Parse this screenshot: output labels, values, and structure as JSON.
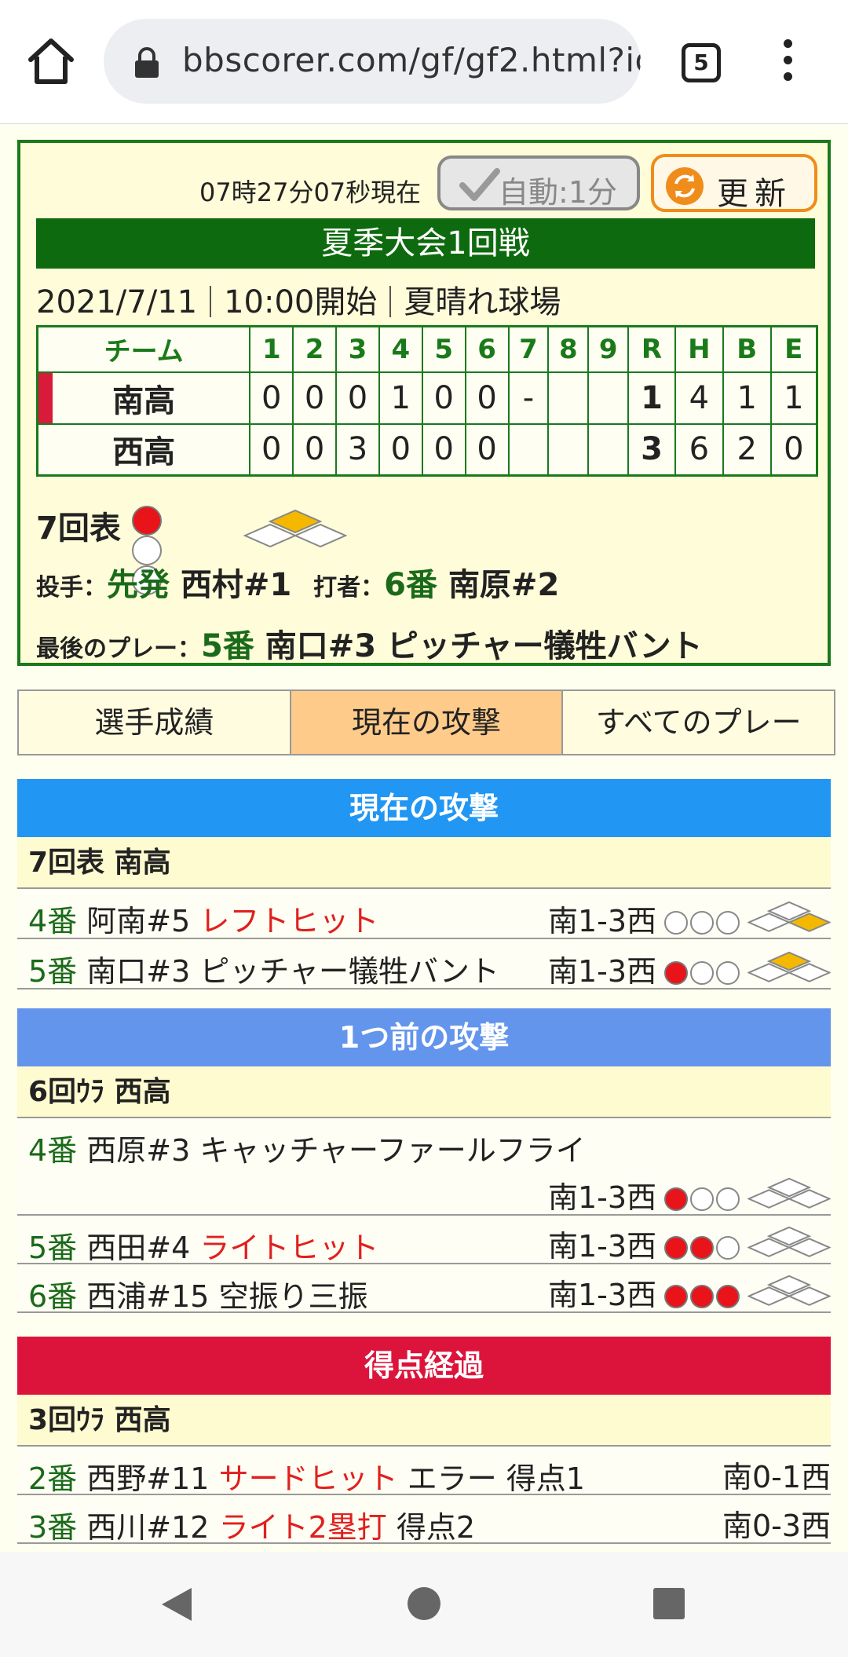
{
  "browser": {
    "url": "bbscorer.com/gf/gf2.html?id",
    "tab_count": "5"
  },
  "score": {
    "time_text": "07時27分07秒現在",
    "auto_label": "自動:1分",
    "refresh_label": "更新",
    "tournament": "夏季大会1回戦",
    "date": "2021/7/11",
    "start": "10:00開始",
    "venue": "夏晴れ球場",
    "headers": [
      "チーム",
      "1",
      "2",
      "3",
      "4",
      "5",
      "6",
      "7",
      "8",
      "9",
      "R",
      "H",
      "B",
      "E"
    ],
    "teams": [
      {
        "name": "南高",
        "innings": [
          "0",
          "0",
          "0",
          "1",
          "0",
          "0",
          "-",
          "",
          ""
        ],
        "r": "1",
        "h": "4",
        "b": "1",
        "e": "1",
        "batting": true
      },
      {
        "name": "西高",
        "innings": [
          "0",
          "0",
          "3",
          "0",
          "0",
          "0",
          "",
          "",
          ""
        ],
        "r": "3",
        "h": "6",
        "b": "2",
        "e": "0",
        "batting": false
      }
    ],
    "inning": "7回表",
    "outs": 1,
    "runners": {
      "first": false,
      "second": true,
      "third": false
    },
    "pitcher_label": "投手：",
    "pitcher_role": "先発",
    "pitcher_name": "西村#1",
    "batter_label": "打者：",
    "batter_order": "6番",
    "batter_name": "南原#2",
    "lastplay_label": "最後のプレー：",
    "lastplay_order": "5番",
    "lastplay_text": "南口#3 ピッチャー犠牲バント"
  },
  "tabs": [
    {
      "label": "選手成績",
      "active": false
    },
    {
      "label": "現在の攻撃",
      "active": true
    },
    {
      "label": "すべてのプレー",
      "active": false
    }
  ],
  "sections": {
    "current": {
      "header": "現在の攻撃",
      "color": "#2196f3",
      "sub": "7回表 南高",
      "plays": [
        {
          "order": "4番",
          "player": "阿南#5",
          "result": "レフトヒット",
          "extra": "",
          "score": "南1-3西",
          "outs": 0,
          "first": true,
          "second": false,
          "third": false
        },
        {
          "order": "5番",
          "player": "南口#3",
          "result": "",
          "extra": "ピッチャー犠牲バント",
          "score": "南1-3西",
          "outs": 1,
          "first": false,
          "second": true,
          "third": false
        }
      ]
    },
    "previous": {
      "header": "1つ前の攻撃",
      "color": "#6495ed",
      "sub": "6回ｳﾗ 西高",
      "plays": [
        {
          "order": "4番",
          "player": "西原#3",
          "result": "",
          "extra": "キャッチャーファールフライ",
          "score": "南1-3西",
          "outs": 1,
          "first": false,
          "second": false,
          "third": false
        },
        {
          "order": "5番",
          "player": "西田#4",
          "result": "ライトヒット",
          "extra": "",
          "score": "南1-3西",
          "outs": 2,
          "first": false,
          "second": false,
          "third": false
        },
        {
          "order": "6番",
          "player": "西浦#15",
          "result": "",
          "extra": "空振り三振",
          "score": "南1-3西",
          "outs": 3,
          "first": false,
          "second": false,
          "third": false
        }
      ]
    },
    "scoring": {
      "header": "得点経過",
      "color": "#dc143c",
      "sub": "3回ｳﾗ 西高",
      "plays": [
        {
          "order": "2番",
          "player": "西野#11",
          "result": "サードヒット",
          "extra": "エラー 得点1",
          "score": "南0-1西"
        },
        {
          "order": "3番",
          "player": "西川#12",
          "result": "ライト2塁打",
          "extra": "得点2",
          "score": "南0-3西"
        }
      ]
    }
  }
}
